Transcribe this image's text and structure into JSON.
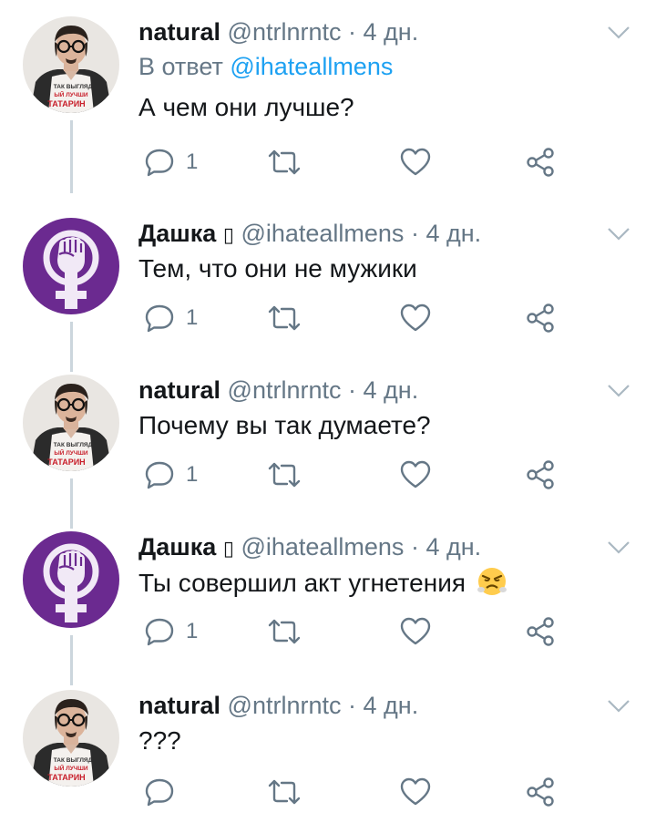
{
  "tweets": [
    {
      "name": "natural",
      "handle": "@ntrlnrntc",
      "time": "· 4 дн.",
      "reply_prefix": "В ответ",
      "reply_mention": "@ihateallmens",
      "text": "А чем они лучше?",
      "reply_count": "1",
      "avatar": "man-portrait"
    },
    {
      "name": "Дашка",
      "name_suffix": "▯",
      "handle": "@ihateallmens",
      "time": "· 4 дн.",
      "text": "Тем, что они не мужики",
      "reply_count": "1",
      "avatar": "feminist-fist"
    },
    {
      "name": "natural",
      "handle": "@ntrlnrntc",
      "time": "· 4 дн.",
      "text": "Почему вы так думаете?",
      "reply_count": "1",
      "avatar": "man-portrait"
    },
    {
      "name": "Дашка",
      "name_suffix": "▯",
      "handle": "@ihateallmens",
      "time": "· 4 дн.",
      "text": "Ты совершил акт угнетения",
      "emoji": "angry-face",
      "reply_count": "1",
      "avatar": "feminist-fist"
    },
    {
      "name": "natural",
      "handle": "@ntrlnrntc",
      "time": "· 4 дн.",
      "text": "???",
      "reply_count": "",
      "avatar": "man-portrait"
    }
  ],
  "avatar_shirt_text": [
    "ТАК ВЫГЛЯД",
    "ЫЙ ЛУЧШИ",
    "ТАТАРИН"
  ],
  "colors": {
    "accent": "#1da1f2",
    "secondary_text": "#657786",
    "thread_line": "#ccd6dd",
    "feminist_purple": "#6b2a90"
  }
}
